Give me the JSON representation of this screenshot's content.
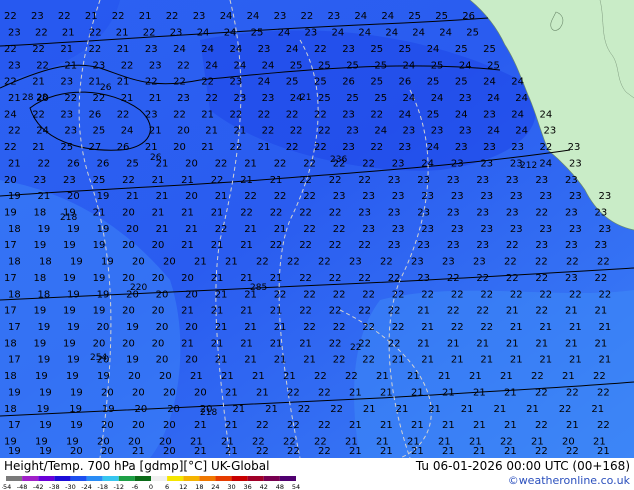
{
  "footer": {
    "title": "Height/Temp. 700 hPa [gdmp][°C] UK-Global",
    "valid": "Tu 06-01-2026 00:00 UTC (00+168)",
    "credit": "©weatheronline.co.uk"
  },
  "colorbar": {
    "ticks": [
      "-54",
      "-48",
      "-42",
      "-38",
      "-30",
      "-24",
      "-18",
      "-12",
      "-6",
      "0",
      "6",
      "12",
      "18",
      "24",
      "30",
      "36",
      "42",
      "48",
      "54"
    ],
    "colors": [
      "#7a7a7a",
      "#a020c8",
      "#6a00d8",
      "#1c0cd8",
      "#1e50f0",
      "#2a8cf5",
      "#37c6f0",
      "#1ea046",
      "#0b6b18",
      "#f0f0f0",
      "#f5e600",
      "#f5b400",
      "#f07800",
      "#e63c00",
      "#c80000",
      "#a00028",
      "#780050",
      "#500070"
    ]
  },
  "map": {
    "colors": {
      "ocean_dark": "#1d45e8",
      "ocean_mid": "#2c62f2",
      "ocean_light": "#3c80f6",
      "land": "#c9ecc7",
      "label": "#000000"
    }
  },
  "labels": {
    "rows": [
      "22 23 22 21 22 21 22 23 24 24 23 22 23 24 24 25 25 26 27 27 25 26 25",
      "23 22 21 22 21 22 23 24 24 25 24 23 24 24 24 24 24 25 26 24 25 25 25",
      "22 22 21 22 21 23 24 24 24 23 24 22 23 25 25 24 25 25 24 24 23 25",
      "23 22 21 23 22 23 22 24 24 24 25 25 25 25 24 25 24 25 25 24 25 25",
      "22 21 23 21 21 22 22 22 23 24 25 25 26 25 26 25 25 24 24 24 24 25",
      "21 20 22 22 21 21 23 22 23 23 24 25 25 25 24 24 23 24 24 24 25 24",
      "24 22 23 26 22 23 22 21 22 22 22 22 23 22 24 25 24 23 24 24 23 23",
      "22 24 23 25 24 21 20 21 21 22 22 22 23 24 23 23 23 24 24 23 23 24",
      "22 21 25 27 26 21 20 21 22 21 22 22 23 22 23 24 23 23 23 22 23 24",
      "21 22 26 26 25 21 20 22 21 22 22 22 22 23 24 23 23 23 24 23 23",
      "20 23 23 25 22 21 21 22 21 21 22 22 22 23 23 23 23 23 23 23 23",
      "19 21 20 19 21 21 20 21 22 22 22 23 23 23 23 23 23 23 23 23 23",
      "19 18 19 21 20 21 21 21 22 22 22 22 23 23 23 23 23 23 22 23 23",
      "18 19 19 19 20 21 21 22 21 21 22 22 23 23 23 23 23 23 23 23 23",
      "17 19 19 19 20 20 21 21 21 22 22 22 22 23 23 23 23 22 23 23 23",
      "18 18 19 19 20 20 21 21 22 22 22 23 22 23 23 23 22 22 22 22",
      "17 18 19 19 20 20 20 21 21 21 22 22 22 22 23 22 22 22 22 23 22",
      "18 18 19 19 20 20 20 21 21 22 22 22 22 22 22 22 22 22 22 22 22",
      "17 19 19 19 20 20 21 21 21 21 22 22 22 22 21 22 22 21 22 21 21",
      "17 19 19 20 19 20 20 21 21 21 22 22 22 22 21 22 22 21 21 21 21",
      "18 19 19 20 20 20 21 21 21 21 21 22 22 22 21 21 21 21 21 21 21",
      "17 19 19 20 19 20 20 21 21 21 21 22 22 21 21 21 21 21 21 21 21",
      "18 19 19 19 20 20 21 21 21 21 22 22 21 21 21 21 21 22 21 22",
      "19 19 19 20 20 20 20 21 21 22 22 21 21 21 21 21 21 22 22 22",
      "18 19 19 19 20 20 20 21 21 22 22 21 21 21 21 21 21 22 21",
      "17 19 19 20 20 20 21 21 22 22 22 21 21 21 21 21 21 22 21 22",
      "19 19 19 20 20 20 21 21 22 22 22 21 21 21 21 21 22 21 20 21",
      "19 19 20 20 21 20 21 21 22 22 22 21 21 21 21 21 21 22 22 21"
    ],
    "highlights": [
      "28 28",
      "26",
      "26",
      "236",
      "212",
      "218",
      "220",
      "285",
      "22",
      "218",
      "254",
      "21"
    ]
  }
}
